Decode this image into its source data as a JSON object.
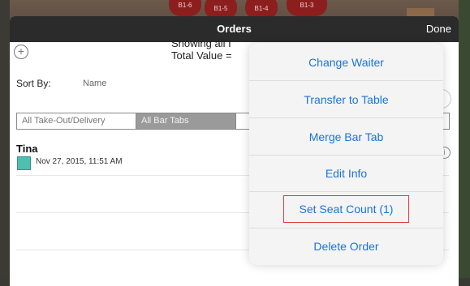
{
  "background": {
    "table_chips": [
      "B1-6",
      "B1-5",
      "B1-4",
      "B1-3"
    ]
  },
  "nav": {
    "title": "Orders",
    "done_label": "Done"
  },
  "summary": {
    "line1": "Showing all I",
    "line2": "Total Value ="
  },
  "sort": {
    "label": "Sort By:",
    "value": "Name"
  },
  "filters": {
    "segments": [
      "All Take-Out/Delivery",
      "All Bar Tabs"
    ],
    "selected": "All Bar Tabs"
  },
  "orders": [
    {
      "name": "Tina",
      "date": "Nov 27, 2015, 11:51 AM",
      "color": "#4fbfb0"
    }
  ],
  "popover": {
    "actions": [
      "Change Waiter",
      "Transfer to Table",
      "Merge Bar Tab",
      "Edit Info",
      "Set Seat Count (1)",
      "Delete Order"
    ],
    "highlighted": "Set Seat Count (1)"
  },
  "colors": {
    "accent": "#1c73d8",
    "highlight_border": "#e03a3a",
    "nav_bar": "#2b2b2b",
    "order_swatch": "#4fbfb0"
  }
}
